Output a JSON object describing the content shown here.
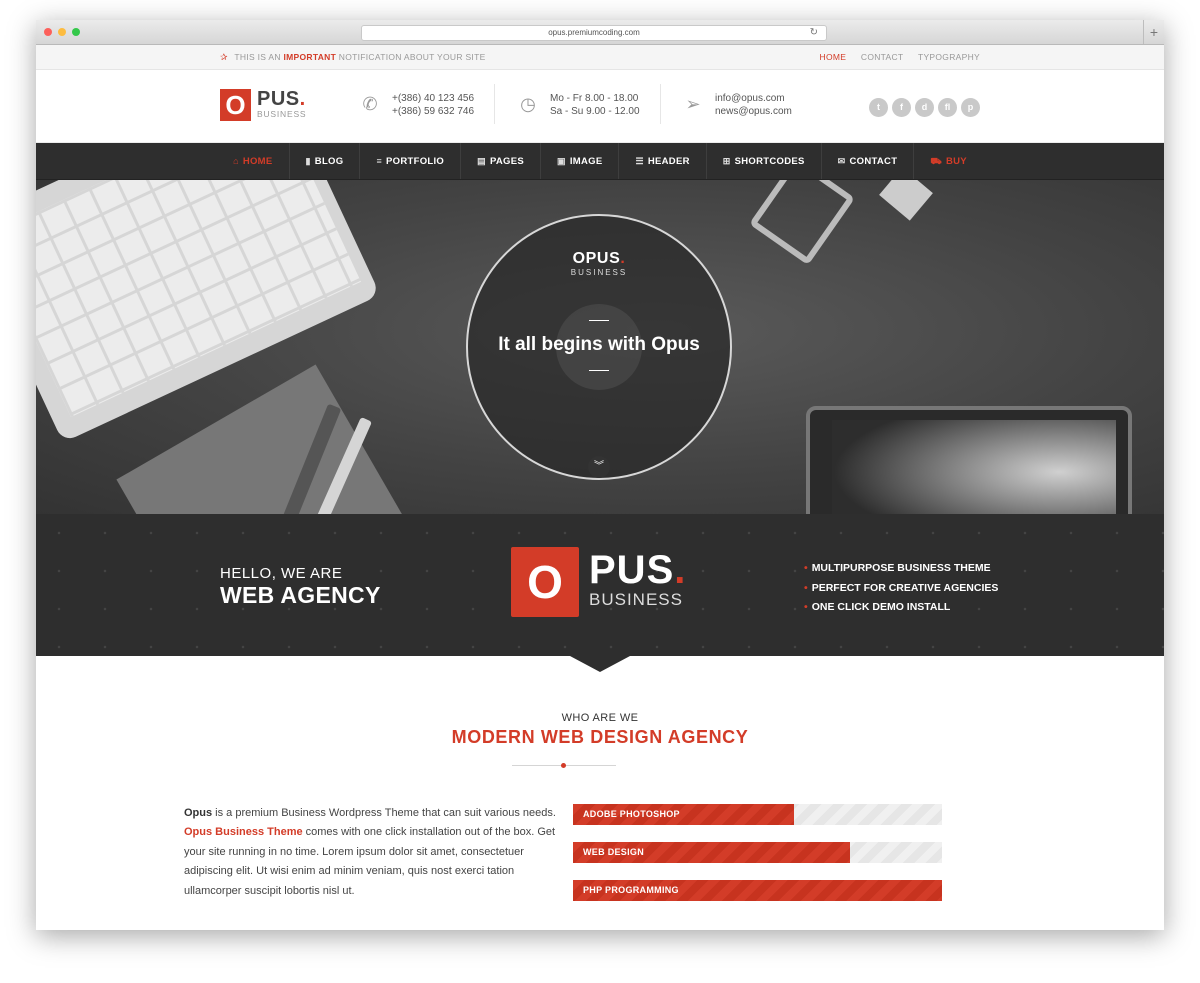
{
  "browser": {
    "url": "opus.premiumcoding.com",
    "reload_icon": "reload-icon",
    "plus_label": "+"
  },
  "notification": {
    "icon": "pin-icon",
    "prefix": "THIS IS AN",
    "important": "IMPORTANT",
    "suffix": "NOTIFICATION ABOUT YOUR SITE"
  },
  "top_links": [
    "HOME",
    "CONTACT",
    "TYPOGRAPHY"
  ],
  "logo": {
    "letter": "O",
    "name": "PUS",
    "dot": ".",
    "sub": "BUSINESS"
  },
  "header_info": {
    "phone": [
      "+(386) 40 123 456",
      "+(386) 59 632 746"
    ],
    "hours": [
      "Mo - Fr 8.00 - 18.00",
      "Sa - Su 9.00 - 12.00"
    ],
    "email": [
      "info@opus.com",
      "news@opus.com"
    ]
  },
  "socials": [
    "t",
    "f",
    "d",
    "fl",
    "p"
  ],
  "nav": [
    {
      "label": "HOME",
      "icon": "home-icon",
      "glyph": "⌂"
    },
    {
      "label": "BLOG",
      "icon": "book-icon",
      "glyph": "▮"
    },
    {
      "label": "PORTFOLIO",
      "icon": "list-icon",
      "glyph": "≡"
    },
    {
      "label": "PAGES",
      "icon": "page-icon",
      "glyph": "▤"
    },
    {
      "label": "IMAGE",
      "icon": "image-icon",
      "glyph": "▣"
    },
    {
      "label": "HEADER",
      "icon": "header-icon",
      "glyph": "☰"
    },
    {
      "label": "SHORTCODES",
      "icon": "plus-square-icon",
      "glyph": "⊞"
    },
    {
      "label": "CONTACT",
      "icon": "envelope-icon",
      "glyph": "✉"
    },
    {
      "label": "BUY",
      "icon": "cart-icon",
      "glyph": "⛟"
    }
  ],
  "hero": {
    "logo_name": "OPUS",
    "logo_dot": ".",
    "logo_sub": "BUSINESS",
    "title": "It all begins with Opus",
    "arrow": "︾"
  },
  "band": {
    "hello": "HELLO, WE ARE",
    "agency": "WEB AGENCY",
    "features": [
      "MULTIPURPOSE BUSINESS THEME",
      "PERFECT FOR CREATIVE AGENCIES",
      "ONE CLICK DEMO INSTALL"
    ]
  },
  "about": {
    "kicker": "WHO ARE WE",
    "heading": "MODERN WEB DESIGN AGENCY",
    "para_brand": "Opus",
    "para_1": " is a premium Business Wordpress Theme that can suit various needs. ",
    "para_link": "Opus Business Theme",
    "para_2": " comes with one click installation out of the box. Get your site running in no time. Lorem ipsum dolor sit amet, consectetuer adipiscing elit. Ut wisi enim ad minim veniam, quis nost exerci tation ullamcorper suscipit lobortis nisl ut."
  },
  "skills": [
    {
      "label": "ADOBE PHOTOSHOP",
      "percent": 60
    },
    {
      "label": "WEB DESIGN",
      "percent": 75
    },
    {
      "label": "PHP PROGRAMMING",
      "percent": 100
    }
  ],
  "colors": {
    "accent": "#d33c28",
    "dark": "#2e2e2e"
  }
}
